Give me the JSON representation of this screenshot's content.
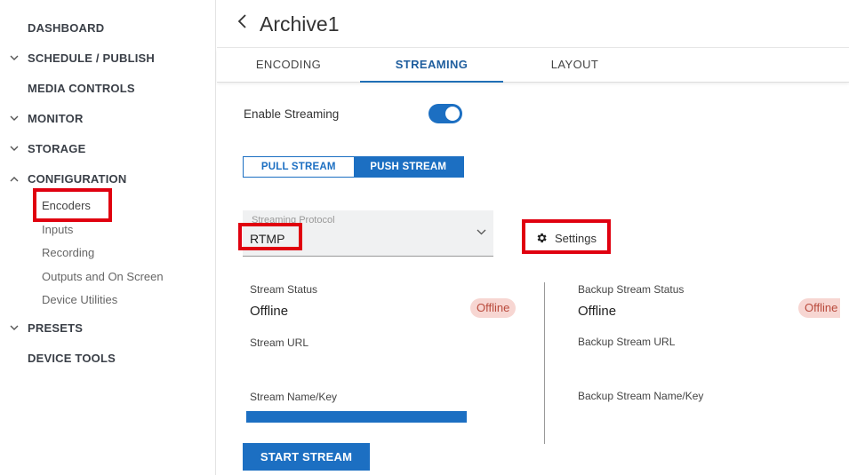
{
  "sidebar": {
    "items": [
      {
        "label": "DASHBOARD",
        "chevron": ""
      },
      {
        "label": "SCHEDULE / PUBLISH",
        "chevron": "down"
      },
      {
        "label": "MEDIA CONTROLS",
        "chevron": ""
      },
      {
        "label": "MONITOR",
        "chevron": "down"
      },
      {
        "label": "STORAGE",
        "chevron": "down"
      },
      {
        "label": "CONFIGURATION",
        "chevron": "up"
      },
      {
        "label": "PRESETS",
        "chevron": "down"
      },
      {
        "label": "DEVICE TOOLS",
        "chevron": ""
      }
    ],
    "config_sub": [
      "Encoders",
      "Inputs",
      "Recording",
      "Outputs and On Screen",
      "Device Utilities"
    ]
  },
  "header": {
    "back_icon": "chevron-left-icon",
    "title": "Archive1"
  },
  "tabs": [
    {
      "label": "ENCODING"
    },
    {
      "label": "STREAMING"
    },
    {
      "label": "LAYOUT"
    }
  ],
  "streaming": {
    "enable_label": "Enable Streaming",
    "enabled": true,
    "mode": {
      "pull": "PULL STREAM",
      "push": "PUSH STREAM",
      "selected": "PUSH STREAM"
    },
    "protocol": {
      "label": "Streaming Protocol",
      "value": "RTMP"
    },
    "settings_label": "Settings",
    "primary": {
      "status_label": "Stream Status",
      "status_value": "Offline",
      "badge": "Offline",
      "url_label": "Stream URL",
      "key_label": "Stream Name/Key"
    },
    "backup": {
      "status_label": "Backup Stream Status",
      "status_value": "Offline",
      "badge": "Offline",
      "url_label": "Backup Stream URL",
      "key_label": "Backup Stream Name/Key"
    },
    "start_label": "START STREAM"
  },
  "colors": {
    "accent": "#1c6fc2",
    "highlight": "#e0000f",
    "offline_badge_bg": "#f7d6d2",
    "offline_badge_text": "#b94a3c"
  }
}
